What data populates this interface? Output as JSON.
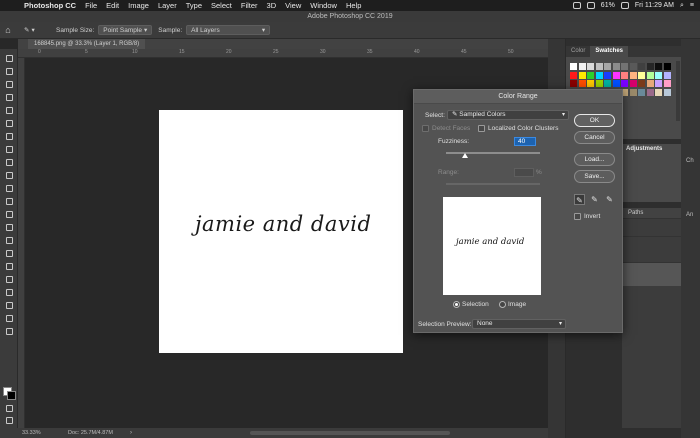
{
  "menubar": {
    "apple": "",
    "items": [
      "Photoshop CC",
      "File",
      "Edit",
      "Image",
      "Layer",
      "Type",
      "Select",
      "Filter",
      "3D",
      "View",
      "Window",
      "Help"
    ],
    "battery": "61%",
    "clock": "Fri 11:29 AM"
  },
  "window": {
    "title": "Adobe Photoshop CC 2019"
  },
  "options": {
    "sample_size_label": "Sample Size:",
    "sample_size_value": "Point Sample",
    "sample_label": "Sample:",
    "sample_value": "All Layers"
  },
  "document": {
    "tab_title": "168845.png @ 33.3% (Layer 1, RGB/8)",
    "canvas_text": "jamie and david",
    "ruler_labels": [
      "0",
      "5",
      "10",
      "15",
      "20",
      "25",
      "30",
      "35",
      "40",
      "45",
      "50"
    ]
  },
  "status": {
    "zoom": "33.33%",
    "doc": "Doc: 25.7M/4.87M"
  },
  "panels": {
    "tabs": [
      "Color",
      "Swatches"
    ],
    "active_tab": "Swatches",
    "adjustments_label": "Adjustments",
    "paths_label": "Paths",
    "side_labels": [
      "Ch",
      "An"
    ],
    "swatch_colors": [
      "#ffffff",
      "#f1f1f1",
      "#d9d9d9",
      "#bfbfbf",
      "#a6a6a6",
      "#8c8c8c",
      "#737373",
      "#595959",
      "#404040",
      "#262626",
      "#0d0d0d",
      "#000000",
      "#ff1a1a",
      "#ffea00",
      "#2cd12c",
      "#00d5ff",
      "#1a3cff",
      "#ff33ff",
      "#ff8080",
      "#ffb380",
      "#ffff99",
      "#b3ff99",
      "#99ffff",
      "#b3b3ff",
      "#8a0000",
      "#ff4d00",
      "#ffc800",
      "#9bd400",
      "#00b3a1",
      "#0050ff",
      "#7a00ff",
      "#d6006b",
      "#7a3a1a",
      "#e6a87a",
      "#c8a0ff",
      "#ff9ec8",
      "#5a1a1a",
      "#7a5a2a",
      "#2a5a2a",
      "#1a3a6a",
      "#3a1a6a",
      "#6a1a4a",
      "#c4a87a",
      "#9a8a6a",
      "#6a8a9a",
      "#9a6a8a",
      "#e8d8b8",
      "#b8c8d8"
    ]
  },
  "dialog": {
    "title": "Color Range",
    "select_label": "Select:",
    "select_value": "Sampled Colors",
    "detect_faces_label": "Detect Faces",
    "localized_label": "Localized Color Clusters",
    "fuzziness_label": "Fuzziness:",
    "fuzziness_value": "40",
    "fuzziness_level": 0.2,
    "range_label": "Range:",
    "range_unit": "%",
    "preview_text": "jamie and david",
    "selection_radio": "Selection",
    "image_radio": "Image",
    "selection_preview_label": "Selection Preview:",
    "selection_preview_value": "None",
    "ok_label": "OK",
    "cancel_label": "Cancel",
    "load_label": "Load...",
    "save_label": "Save...",
    "invert_label": "Invert",
    "eyedropper_icons": [
      "eyedropper-icon",
      "eyedropper-plus-icon",
      "eyedropper-minus-icon"
    ]
  }
}
